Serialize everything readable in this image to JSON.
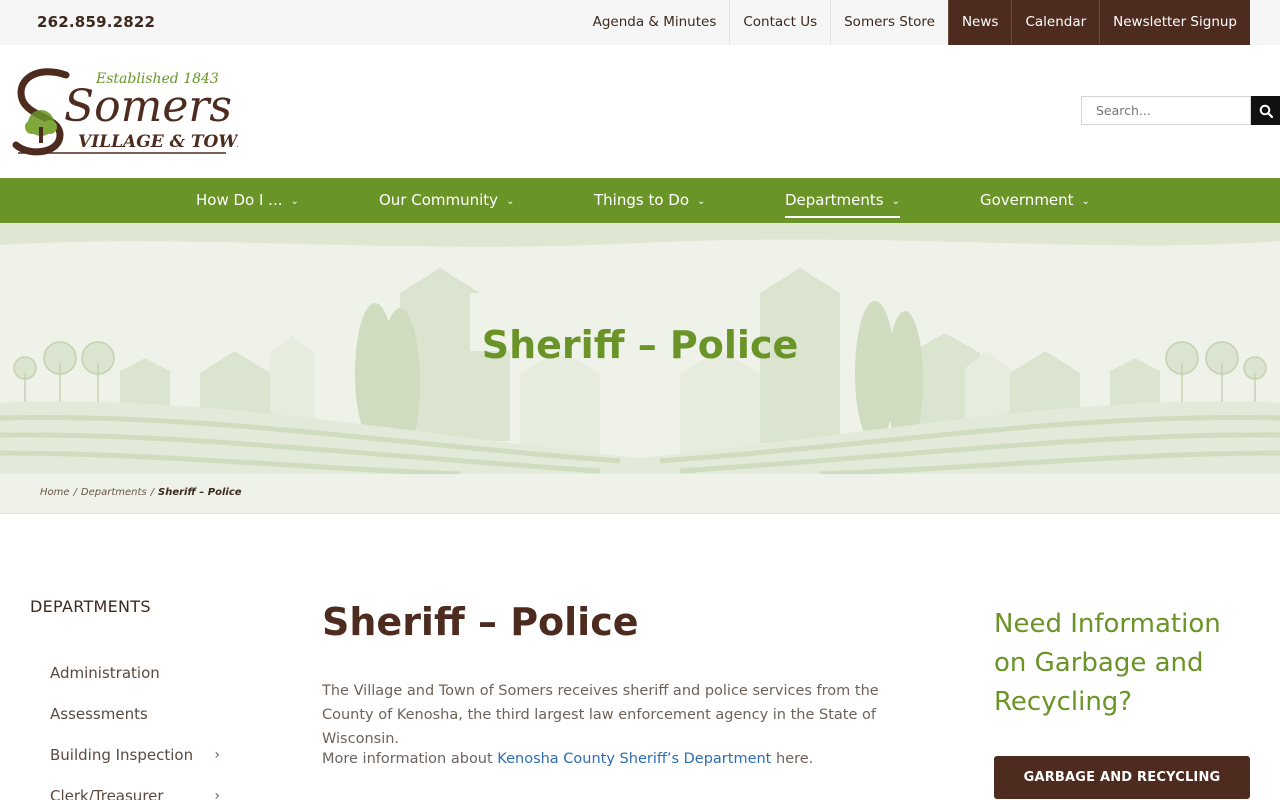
{
  "topbar": {
    "phone": "262.859.2822",
    "links": [
      "Agenda & Minutes",
      "Contact Us",
      "Somers Store"
    ],
    "dark_links": [
      "News",
      "Calendar",
      "Newsletter Signup"
    ]
  },
  "logo": {
    "established": "Established 1843",
    "name": "Somers",
    "tagline": "VILLAGE & TOWN"
  },
  "search": {
    "placeholder": "Search..."
  },
  "nav": {
    "items": [
      {
        "label": "How Do I ..."
      },
      {
        "label": "Our Community"
      },
      {
        "label": "Things to Do"
      },
      {
        "label": "Departments",
        "active": true
      },
      {
        "label": "Government"
      }
    ]
  },
  "hero": {
    "title": "Sheriff – Police"
  },
  "breadcrumb": {
    "home": "Home",
    "departments": "Departments",
    "current": "Sheriff – Police",
    "separator": "/"
  },
  "sidebar": {
    "title": "DEPARTMENTS",
    "items": [
      {
        "label": "Administration",
        "has_children": false
      },
      {
        "label": "Assessments",
        "has_children": false
      },
      {
        "label": "Building Inspection",
        "has_children": true
      },
      {
        "label": "Clerk/Treasurer",
        "has_children": true
      }
    ]
  },
  "main": {
    "title": "Sheriff – Police",
    "paragraph1": "The Village and Town of Somers receives sheriff and police services from the County of Kenosha, the third largest law enforcement agency in the State of Wisconsin.",
    "paragraph2_before": "More information about ",
    "paragraph2_link": "Kenosha County Sheriff’s Department",
    "paragraph2_after": " here."
  },
  "widget": {
    "title": "Need Information on Garbage and Recycling?",
    "button": "GARBAGE AND RECYCLING"
  },
  "colors": {
    "brand_brown": "#4e2b1f",
    "brand_green": "#6a9427",
    "link_blue": "#2e6db4"
  }
}
